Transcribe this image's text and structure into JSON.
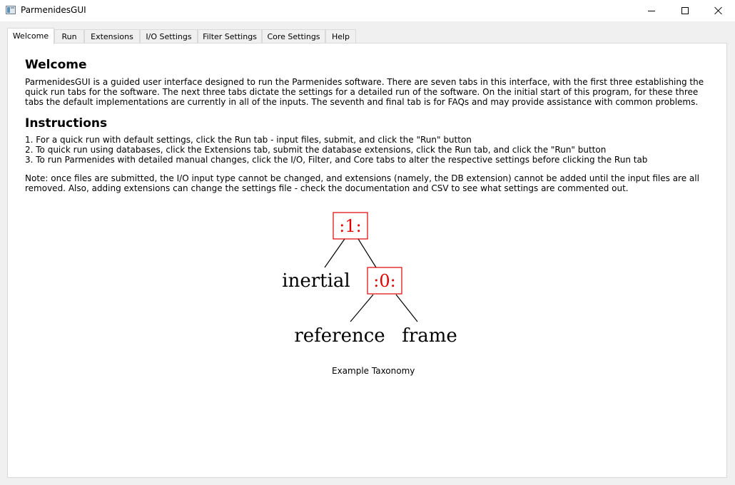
{
  "window": {
    "title": "ParmenidesGUI"
  },
  "tabs": [
    {
      "label": "Welcome",
      "active": true
    },
    {
      "label": "Run",
      "active": false
    },
    {
      "label": "Extensions",
      "active": false
    },
    {
      "label": "I/O Settings",
      "active": false
    },
    {
      "label": "Filter Settings",
      "active": false
    },
    {
      "label": "Core Settings",
      "active": false
    },
    {
      "label": "Help",
      "active": false
    }
  ],
  "welcome": {
    "heading": "Welcome",
    "intro": "ParmenidesGUI is a guided user interface designed to run the Parmenides software. There are seven tabs in this interface, with the first three establishing the quick run tabs for the software. The next three tabs dictate the settings for a detailed run of the software. On the initial start of this program, for these three tabs the default implementations are currently in all of the inputs. The seventh and final tab is for FAQs and may provide assistance with common problems.",
    "instructions_heading": "Instructions",
    "steps": [
      "1. For a quick run with default settings, click the Run tab - input files, submit, and click the \"Run\" button",
      "2. To quick run using databases, click the Extensions tab, submit the database extensions, click the Run tab, and click the \"Run\" button",
      "3. To run Parmenides with detailed manual changes, click the I/O, Filter, and Core tabs to alter the respective settings before clicking the Run tab"
    ],
    "note": "Note: once files are submitted, the I/O input type cannot be changed, and extensions (namely, the DB extension) cannot be added until the input files are all removed. Also, adding extensions can change the settings file - check the documentation and CSV to see what settings are commented out."
  },
  "taxonomy": {
    "root_node": ":1:",
    "inner_node": ":0:",
    "leaves": {
      "left": "inertial",
      "inner_left": "reference",
      "inner_right": "frame"
    },
    "node_color": "#e00000",
    "caption": "Example Taxonomy"
  }
}
